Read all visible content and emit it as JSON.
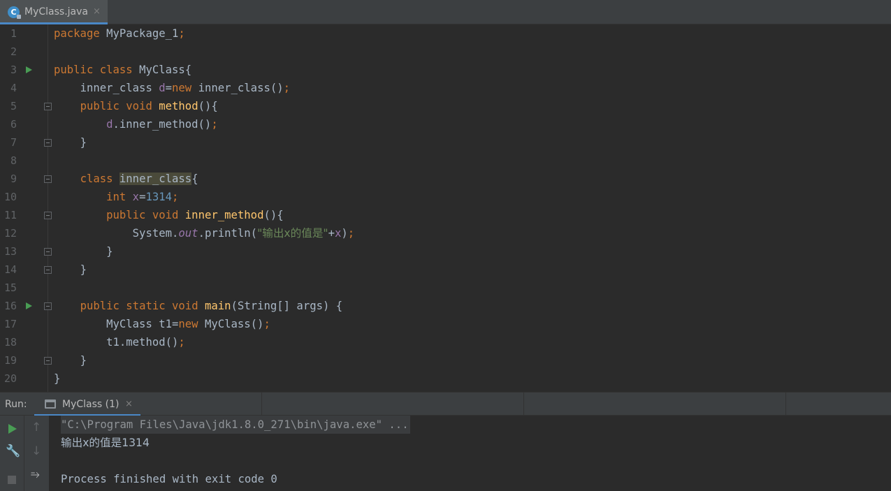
{
  "tab": {
    "icon": "java-class-icon",
    "filename": "MyClass.java",
    "close": "×"
  },
  "editor": {
    "lines": [
      {
        "num": "1"
      },
      {
        "num": "2"
      },
      {
        "num": "3"
      },
      {
        "num": "4"
      },
      {
        "num": "5"
      },
      {
        "num": "6"
      },
      {
        "num": "7"
      },
      {
        "num": "8"
      },
      {
        "num": "9"
      },
      {
        "num": "10"
      },
      {
        "num": "11"
      },
      {
        "num": "12"
      },
      {
        "num": "13"
      },
      {
        "num": "14"
      },
      {
        "num": "15"
      },
      {
        "num": "16"
      },
      {
        "num": "17"
      },
      {
        "num": "18"
      },
      {
        "num": "19"
      },
      {
        "num": "20"
      }
    ],
    "code": {
      "l1": {
        "kw": "package",
        "name": "MyPackage_1",
        "semi": ";"
      },
      "l3": {
        "kw1": "public",
        "kw2": "class",
        "name": "MyClass",
        "brace": "{"
      },
      "l4": {
        "type": "inner_class",
        "var": "d",
        "eq": "=",
        "kw": "new",
        "call": "inner_class()",
        "semi": ";"
      },
      "l5": {
        "kw1": "public",
        "kw2": "void",
        "fn": "method",
        "rest": "(){"
      },
      "l6": {
        "var": "d",
        "call": ".inner_method()",
        "semi": ";"
      },
      "l7": {
        "text": "}"
      },
      "l9": {
        "kw": "class",
        "name": "inner_class",
        "brace": "{"
      },
      "l10": {
        "kw": "int",
        "var": "x",
        "eq": "=",
        "num": "1314",
        "semi": ";"
      },
      "l11": {
        "kw1": "public",
        "kw2": "void",
        "fn": "inner_method",
        "rest": "(){"
      },
      "l12": {
        "cls": "System.",
        "field": "out",
        "call": ".println(",
        "str": "\"输出x的值是\"",
        "plus": "+",
        "var": "x",
        "close": ")",
        "semi": ";"
      },
      "l13": {
        "text": "}"
      },
      "l14": {
        "text": "}"
      },
      "l16": {
        "kw1": "public",
        "kw2": "static",
        "kw3": "void",
        "fn": "main",
        "rest": "(String[] args) {"
      },
      "l17": {
        "type": "MyClass t1=",
        "kw": "new",
        "call": "MyClass()",
        "semi": ";"
      },
      "l18": {
        "call": "t1.method()",
        "semi": ";"
      },
      "l19": {
        "text": "}"
      },
      "l20": {
        "text": "}"
      }
    }
  },
  "run_panel": {
    "title": "Run:",
    "tab_label": "MyClass (1)",
    "tab_close": "×",
    "toolbar": {
      "run": "play-icon",
      "settings": "wrench-icon",
      "stop": "stop-icon",
      "up": "↑",
      "down": "↓",
      "wrap": "⥱"
    },
    "console": {
      "command": "\"C:\\Program Files\\Java\\jdk1.8.0_271\\bin\\java.exe\" ...",
      "output": "输出x的值是1314",
      "blank": "",
      "exit": "Process finished with exit code 0"
    }
  },
  "colors": {
    "keyword": "#cc7832",
    "function": "#ffc66d",
    "field": "#9876aa",
    "number": "#6897bb",
    "string": "#6a8759",
    "run_marker": "#499c54",
    "tab_underline": "#4a88c7"
  }
}
